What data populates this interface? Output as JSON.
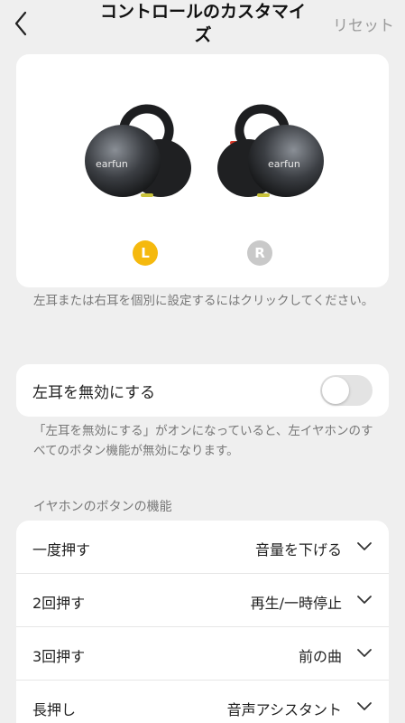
{
  "header": {
    "title": "コントロールのカスタマイズ",
    "reset_label": "リセット"
  },
  "earbuds": {
    "left_badge": "L",
    "right_badge": "R",
    "selected": "L",
    "brand_text": "earfun"
  },
  "hints": {
    "select_ear": "左耳または右耳を個別に設定するにはクリックしてください。",
    "disable_note": "「左耳を無効にする」がオンになっていると、左イヤホンのすべてのボタン機能が無効になります。"
  },
  "disable_toggle": {
    "label": "左耳を無効にする",
    "on": false
  },
  "controls": {
    "section_title": "イヤホンのボタンの機能",
    "rows": [
      {
        "gesture": "一度押す",
        "action": "音量を下げる"
      },
      {
        "gesture": "2回押す",
        "action": "再生/一時停止"
      },
      {
        "gesture": "3回押す",
        "action": "前の曲"
      },
      {
        "gesture": "長押し",
        "action": "音声アシスタント"
      }
    ]
  },
  "colors": {
    "accent": "#f5b90e",
    "background": "#efefef",
    "card": "#ffffff",
    "muted_text": "#777777"
  }
}
